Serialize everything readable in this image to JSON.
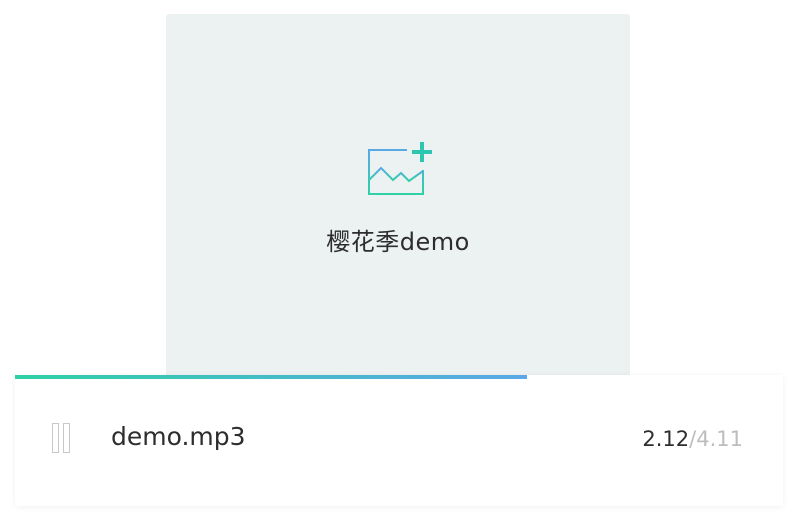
{
  "cover": {
    "title": "樱花季demo",
    "icon": "add-image-icon",
    "background_color": "#ecf1f1"
  },
  "player": {
    "track_name": "demo.mp3",
    "current_time": "2.12",
    "separator": "/",
    "total_time": "4.11",
    "progress_fraction": 0.667,
    "pause_icon": "pause-icon",
    "progress_gradient": [
      "#2fd0a6",
      "#5aa8e6"
    ]
  }
}
